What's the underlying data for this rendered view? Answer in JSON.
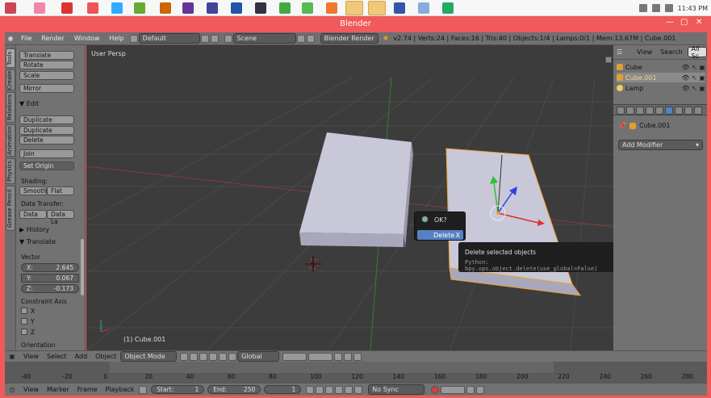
{
  "window": {
    "title": "Blender",
    "clock": "11:43 PM"
  },
  "topbar": {
    "menus": [
      "File",
      "Render",
      "Window",
      "Help"
    ],
    "layout": "Default",
    "scene": "Scene",
    "engine": "Blender Render",
    "stats": "v2.74 | Verts:24 | Faces:16 | Tris:40 | Objects:1/4 | Lamps:0/1 | Mem:13.67M | Cube.001"
  },
  "tabs": [
    "Tools",
    "Create",
    "Relations",
    "Animation",
    "Physics",
    "Grease Pencil"
  ],
  "toolshelf": {
    "transform": [
      "Translate",
      "Rotate",
      "Scale"
    ],
    "mirror": "Mirror",
    "edit_header": "Edit",
    "edit": [
      "Duplicate",
      "Duplicate Linked",
      "Delete"
    ],
    "join": "Join",
    "set_origin": "Set Origin",
    "shading_label": "Shading:",
    "smooth": "Smooth",
    "flat": "Flat",
    "data_transfer_label": "Data Transfer:",
    "data": "Data",
    "data_la": "Data La",
    "history": "History",
    "op_header": "Translate",
    "vector_label": "Vector",
    "x_label": "X:",
    "x_value": "2.645",
    "y_label": "Y:",
    "y_value": "0.067",
    "z_label": "Z:",
    "z_value": "-0.173",
    "constraint_label": "Constraint Axis",
    "axes": [
      "X",
      "Y",
      "Z"
    ],
    "orientation": "Orientation"
  },
  "viewport": {
    "label": "User Persp",
    "object": "(1) Cube.001"
  },
  "popup": {
    "ok": "OK?",
    "delete": "Delete",
    "close": "X"
  },
  "tooltip": {
    "title": "Delete selected objects",
    "python": "Python: bpy.ops.object.delete(use_global=False)"
  },
  "outliner": {
    "view": "View",
    "search": "Search",
    "all": "All Sc",
    "items": [
      "Cube",
      "Cube.001",
      "Lamp"
    ]
  },
  "properties": {
    "object": "Cube.001",
    "add_modifier": "Add Modifier"
  },
  "vp_header": {
    "menus": [
      "View",
      "Select",
      "Add",
      "Object"
    ],
    "mode": "Object Mode",
    "orientation": "Global"
  },
  "timeline": {
    "ticks": [
      "-40",
      "-20",
      "0",
      "20",
      "40",
      "60",
      "80",
      "100",
      "120",
      "140",
      "160",
      "180",
      "200",
      "220",
      "240",
      "260",
      "280"
    ],
    "menus": [
      "View",
      "Marker",
      "Frame",
      "Playback"
    ],
    "start_label": "Start:",
    "start": "1",
    "end_label": "End:",
    "end": "250",
    "current": "1",
    "sync": "No Sync"
  },
  "colors": {
    "window_frame": "#f05a5a",
    "viewport": "#3c3c3c",
    "panel": "#727272",
    "selected": "#5680c2"
  }
}
